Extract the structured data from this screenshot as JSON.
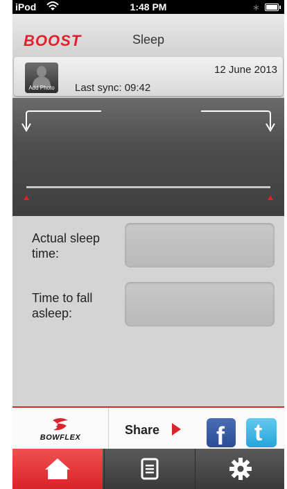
{
  "status_bar": {
    "carrier": "iPod",
    "time": "1:48 PM"
  },
  "header": {
    "logo": "BOOST",
    "title": "Sleep"
  },
  "profile": {
    "avatar_label": "Add Photo",
    "date": "12 June 2013",
    "last_sync": "Last sync: 09:42"
  },
  "form": {
    "actual_sleep_label": "Actual sleep time:",
    "actual_sleep_value": "",
    "fall_asleep_label": "Time to fall asleep:",
    "fall_asleep_value": ""
  },
  "share_bar": {
    "brand": "BOWFLEX",
    "share_label": "Share"
  },
  "tabs": [
    {
      "icon": "home-icon",
      "active": true
    },
    {
      "icon": "list-icon",
      "active": false
    },
    {
      "icon": "gear-icon",
      "active": false
    }
  ],
  "colors": {
    "accent": "#d8262d",
    "facebook": "#3b5998",
    "twitter": "#2fa9df"
  }
}
